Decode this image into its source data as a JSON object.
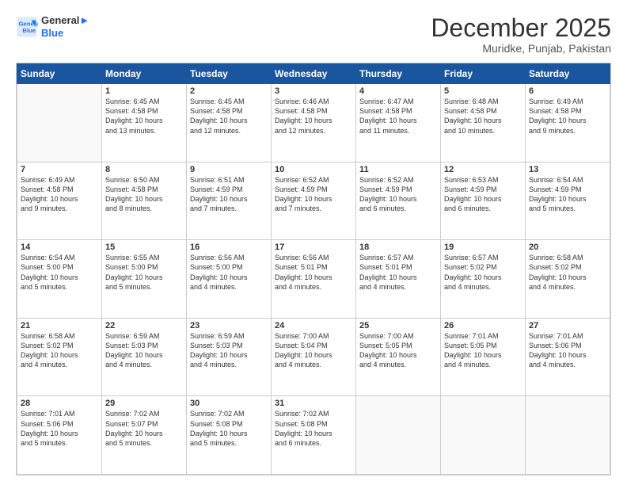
{
  "logo": {
    "line1": "General",
    "line2": "Blue"
  },
  "header": {
    "month": "December 2025",
    "location": "Muridke, Punjab, Pakistan"
  },
  "weekdays": [
    "Sunday",
    "Monday",
    "Tuesday",
    "Wednesday",
    "Thursday",
    "Friday",
    "Saturday"
  ],
  "weeks": [
    [
      {
        "day": "",
        "content": ""
      },
      {
        "day": "1",
        "content": "Sunrise: 6:45 AM\nSunset: 4:58 PM\nDaylight: 10 hours\nand 13 minutes."
      },
      {
        "day": "2",
        "content": "Sunrise: 6:45 AM\nSunset: 4:58 PM\nDaylight: 10 hours\nand 12 minutes."
      },
      {
        "day": "3",
        "content": "Sunrise: 6:46 AM\nSunset: 4:58 PM\nDaylight: 10 hours\nand 12 minutes."
      },
      {
        "day": "4",
        "content": "Sunrise: 6:47 AM\nSunset: 4:58 PM\nDaylight: 10 hours\nand 11 minutes."
      },
      {
        "day": "5",
        "content": "Sunrise: 6:48 AM\nSunset: 4:58 PM\nDaylight: 10 hours\nand 10 minutes."
      },
      {
        "day": "6",
        "content": "Sunrise: 6:49 AM\nSunset: 4:58 PM\nDaylight: 10 hours\nand 9 minutes."
      }
    ],
    [
      {
        "day": "7",
        "content": "Sunrise: 6:49 AM\nSunset: 4:58 PM\nDaylight: 10 hours\nand 9 minutes."
      },
      {
        "day": "8",
        "content": "Sunrise: 6:50 AM\nSunset: 4:58 PM\nDaylight: 10 hours\nand 8 minutes."
      },
      {
        "day": "9",
        "content": "Sunrise: 6:51 AM\nSunset: 4:59 PM\nDaylight: 10 hours\nand 7 minutes."
      },
      {
        "day": "10",
        "content": "Sunrise: 6:52 AM\nSunset: 4:59 PM\nDaylight: 10 hours\nand 7 minutes."
      },
      {
        "day": "11",
        "content": "Sunrise: 6:52 AM\nSunset: 4:59 PM\nDaylight: 10 hours\nand 6 minutes."
      },
      {
        "day": "12",
        "content": "Sunrise: 6:53 AM\nSunset: 4:59 PM\nDaylight: 10 hours\nand 6 minutes."
      },
      {
        "day": "13",
        "content": "Sunrise: 6:54 AM\nSunset: 4:59 PM\nDaylight: 10 hours\nand 5 minutes."
      }
    ],
    [
      {
        "day": "14",
        "content": "Sunrise: 6:54 AM\nSunset: 5:00 PM\nDaylight: 10 hours\nand 5 minutes."
      },
      {
        "day": "15",
        "content": "Sunrise: 6:55 AM\nSunset: 5:00 PM\nDaylight: 10 hours\nand 5 minutes."
      },
      {
        "day": "16",
        "content": "Sunrise: 6:56 AM\nSunset: 5:00 PM\nDaylight: 10 hours\nand 4 minutes."
      },
      {
        "day": "17",
        "content": "Sunrise: 6:56 AM\nSunset: 5:01 PM\nDaylight: 10 hours\nand 4 minutes."
      },
      {
        "day": "18",
        "content": "Sunrise: 6:57 AM\nSunset: 5:01 PM\nDaylight: 10 hours\nand 4 minutes."
      },
      {
        "day": "19",
        "content": "Sunrise: 6:57 AM\nSunset: 5:02 PM\nDaylight: 10 hours\nand 4 minutes."
      },
      {
        "day": "20",
        "content": "Sunrise: 6:58 AM\nSunset: 5:02 PM\nDaylight: 10 hours\nand 4 minutes."
      }
    ],
    [
      {
        "day": "21",
        "content": "Sunrise: 6:58 AM\nSunset: 5:02 PM\nDaylight: 10 hours\nand 4 minutes."
      },
      {
        "day": "22",
        "content": "Sunrise: 6:59 AM\nSunset: 5:03 PM\nDaylight: 10 hours\nand 4 minutes."
      },
      {
        "day": "23",
        "content": "Sunrise: 6:59 AM\nSunset: 5:03 PM\nDaylight: 10 hours\nand 4 minutes."
      },
      {
        "day": "24",
        "content": "Sunrise: 7:00 AM\nSunset: 5:04 PM\nDaylight: 10 hours\nand 4 minutes."
      },
      {
        "day": "25",
        "content": "Sunrise: 7:00 AM\nSunset: 5:05 PM\nDaylight: 10 hours\nand 4 minutes."
      },
      {
        "day": "26",
        "content": "Sunrise: 7:01 AM\nSunset: 5:05 PM\nDaylight: 10 hours\nand 4 minutes."
      },
      {
        "day": "27",
        "content": "Sunrise: 7:01 AM\nSunset: 5:06 PM\nDaylight: 10 hours\nand 4 minutes."
      }
    ],
    [
      {
        "day": "28",
        "content": "Sunrise: 7:01 AM\nSunset: 5:06 PM\nDaylight: 10 hours\nand 5 minutes."
      },
      {
        "day": "29",
        "content": "Sunrise: 7:02 AM\nSunset: 5:07 PM\nDaylight: 10 hours\nand 5 minutes."
      },
      {
        "day": "30",
        "content": "Sunrise: 7:02 AM\nSunset: 5:08 PM\nDaylight: 10 hours\nand 5 minutes."
      },
      {
        "day": "31",
        "content": "Sunrise: 7:02 AM\nSunset: 5:08 PM\nDaylight: 10 hours\nand 6 minutes."
      },
      {
        "day": "",
        "content": ""
      },
      {
        "day": "",
        "content": ""
      },
      {
        "day": "",
        "content": ""
      }
    ]
  ]
}
